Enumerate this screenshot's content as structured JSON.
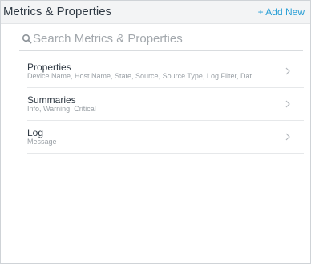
{
  "header": {
    "title": "Metrics & Properties",
    "add_new_label": "+ Add New"
  },
  "search": {
    "placeholder": "Search Metrics & Properties",
    "value": ""
  },
  "items": [
    {
      "title": "Properties",
      "subtitle": "Device Name, Host Name, State, Source, Source Type, Log Filter, Dat..."
    },
    {
      "title": "Summaries",
      "subtitle": "Info, Warning, Critical"
    },
    {
      "title": "Log",
      "subtitle": "Message"
    }
  ],
  "colors": {
    "accent": "#2a9fd6",
    "header_bg": "#f3f4f5",
    "text": "#303a44",
    "muted": "#9aa0a6"
  },
  "icons": {
    "search": "search-icon",
    "chevron": "chevron-right-icon"
  }
}
